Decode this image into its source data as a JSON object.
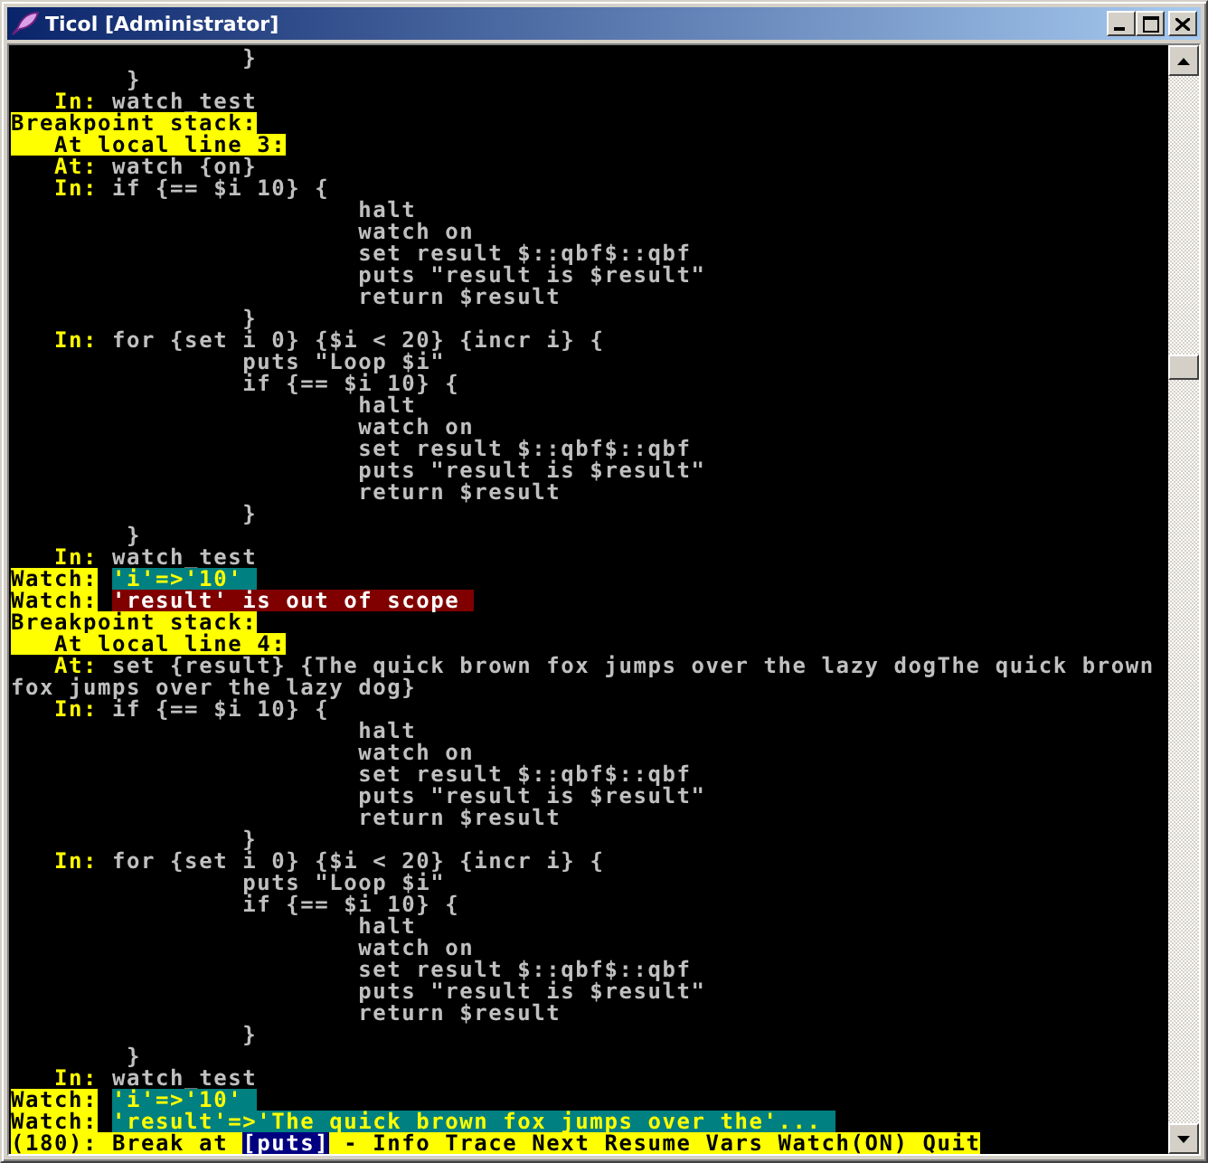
{
  "window": {
    "title": "Ticol [Administrator]"
  },
  "console": {
    "lines": [
      {
        "segments": [
          {
            "kind": "plain",
            "text": "                }"
          }
        ]
      },
      {
        "segments": [
          {
            "kind": "plain",
            "text": "        }"
          }
        ]
      },
      {
        "segments": [
          {
            "kind": "label",
            "text": "   In:"
          },
          {
            "kind": "plain",
            "text": " watch_test"
          }
        ]
      },
      {
        "segments": [
          {
            "kind": "banner",
            "text": "Breakpoint stack:"
          }
        ]
      },
      {
        "segments": [
          {
            "kind": "banner",
            "text": "   At local line 3:"
          }
        ]
      },
      {
        "segments": [
          {
            "kind": "label",
            "text": "   At:"
          },
          {
            "kind": "plain",
            "text": " watch {on}"
          }
        ]
      },
      {
        "segments": [
          {
            "kind": "label",
            "text": "   In:"
          },
          {
            "kind": "plain",
            "text": " if {== $i 10} {"
          }
        ]
      },
      {
        "segments": [
          {
            "kind": "plain",
            "text": "                        halt"
          }
        ]
      },
      {
        "segments": [
          {
            "kind": "plain",
            "text": "                        watch on"
          }
        ]
      },
      {
        "segments": [
          {
            "kind": "plain",
            "text": "                        set result $::qbf$::qbf"
          }
        ]
      },
      {
        "segments": [
          {
            "kind": "plain",
            "text": "                        puts \"result is $result\""
          }
        ]
      },
      {
        "segments": [
          {
            "kind": "plain",
            "text": "                        return $result"
          }
        ]
      },
      {
        "segments": [
          {
            "kind": "plain",
            "text": "                }"
          }
        ]
      },
      {
        "segments": [
          {
            "kind": "label",
            "text": "   In:"
          },
          {
            "kind": "plain",
            "text": " for {set i 0} {$i < 20} {incr i} {"
          }
        ]
      },
      {
        "segments": [
          {
            "kind": "plain",
            "text": "                puts \"Loop $i\""
          }
        ]
      },
      {
        "segments": [
          {
            "kind": "plain",
            "text": "                if {== $i 10} {"
          }
        ]
      },
      {
        "segments": [
          {
            "kind": "plain",
            "text": "                        halt"
          }
        ]
      },
      {
        "segments": [
          {
            "kind": "plain",
            "text": "                        watch on"
          }
        ]
      },
      {
        "segments": [
          {
            "kind": "plain",
            "text": "                        set result $::qbf$::qbf"
          }
        ]
      },
      {
        "segments": [
          {
            "kind": "plain",
            "text": "                        puts \"result is $result\""
          }
        ]
      },
      {
        "segments": [
          {
            "kind": "plain",
            "text": "                        return $result"
          }
        ]
      },
      {
        "segments": [
          {
            "kind": "plain",
            "text": "                }"
          }
        ]
      },
      {
        "segments": [
          {
            "kind": "plain",
            "text": "        }"
          }
        ]
      },
      {
        "segments": [
          {
            "kind": "label",
            "text": "   In:"
          },
          {
            "kind": "plain",
            "text": " watch_test"
          }
        ]
      },
      {
        "segments": [
          {
            "kind": "banner",
            "text": "Watch:"
          },
          {
            "kind": "value",
            "text": "'i'=>'10'"
          }
        ]
      },
      {
        "segments": [
          {
            "kind": "banner",
            "text": "Watch:"
          },
          {
            "kind": "error",
            "text": "'result' is out of scope"
          }
        ]
      },
      {
        "segments": [
          {
            "kind": "banner",
            "text": "Breakpoint stack:"
          }
        ]
      },
      {
        "segments": [
          {
            "kind": "banner",
            "text": "   At local line 4:"
          }
        ]
      },
      {
        "segments": [
          {
            "kind": "label",
            "text": "   At:"
          },
          {
            "kind": "plain",
            "text": " set {result} {The quick brown fox jumps over the lazy dogThe quick brown"
          }
        ]
      },
      {
        "segments": [
          {
            "kind": "plain",
            "text": "fox jumps over the lazy dog}"
          }
        ]
      },
      {
        "segments": [
          {
            "kind": "label",
            "text": "   In:"
          },
          {
            "kind": "plain",
            "text": " if {== $i 10} {"
          }
        ]
      },
      {
        "segments": [
          {
            "kind": "plain",
            "text": "                        halt"
          }
        ]
      },
      {
        "segments": [
          {
            "kind": "plain",
            "text": "                        watch on"
          }
        ]
      },
      {
        "segments": [
          {
            "kind": "plain",
            "text": "                        set result $::qbf$::qbf"
          }
        ]
      },
      {
        "segments": [
          {
            "kind": "plain",
            "text": "                        puts \"result is $result\""
          }
        ]
      },
      {
        "segments": [
          {
            "kind": "plain",
            "text": "                        return $result"
          }
        ]
      },
      {
        "segments": [
          {
            "kind": "plain",
            "text": "                }"
          }
        ]
      },
      {
        "segments": [
          {
            "kind": "label",
            "text": "   In:"
          },
          {
            "kind": "plain",
            "text": " for {set i 0} {$i < 20} {incr i} {"
          }
        ]
      },
      {
        "segments": [
          {
            "kind": "plain",
            "text": "                puts \"Loop $i\""
          }
        ]
      },
      {
        "segments": [
          {
            "kind": "plain",
            "text": "                if {== $i 10} {"
          }
        ]
      },
      {
        "segments": [
          {
            "kind": "plain",
            "text": "                        halt"
          }
        ]
      },
      {
        "segments": [
          {
            "kind": "plain",
            "text": "                        watch on"
          }
        ]
      },
      {
        "segments": [
          {
            "kind": "plain",
            "text": "                        set result $::qbf$::qbf"
          }
        ]
      },
      {
        "segments": [
          {
            "kind": "plain",
            "text": "                        puts \"result is $result\""
          }
        ]
      },
      {
        "segments": [
          {
            "kind": "plain",
            "text": "                        return $result"
          }
        ]
      },
      {
        "segments": [
          {
            "kind": "plain",
            "text": "                }"
          }
        ]
      },
      {
        "segments": [
          {
            "kind": "plain",
            "text": "        }"
          }
        ]
      },
      {
        "segments": [
          {
            "kind": "label",
            "text": "   In:"
          },
          {
            "kind": "plain",
            "text": " watch_test"
          }
        ]
      },
      {
        "segments": [
          {
            "kind": "banner",
            "text": "Watch:"
          },
          {
            "kind": "value",
            "text": "'i'=>'10'"
          }
        ]
      },
      {
        "segments": [
          {
            "kind": "banner",
            "text": "Watch:"
          },
          {
            "kind": "value",
            "text": "'result'=>'The quick brown fox jumps over the'..."
          }
        ]
      },
      {
        "segments": [
          {
            "kind": "banner",
            "text": "(180): Break at "
          },
          {
            "kind": "selected",
            "text": "[puts]"
          },
          {
            "kind": "banner",
            "text": " - Info Trace Next Resume Vars Watch(ON) Quit"
          }
        ]
      }
    ]
  }
}
